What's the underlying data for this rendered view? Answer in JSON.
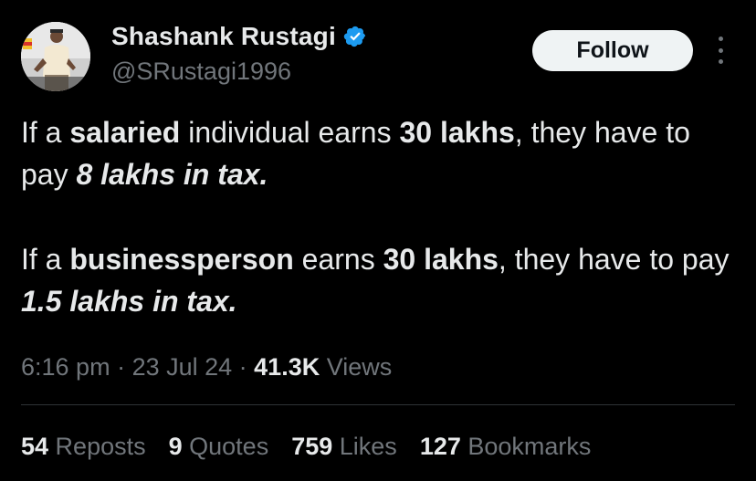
{
  "author": {
    "display_name": "Shashank Rustagi",
    "handle": "@SRustagi1996",
    "verified": true,
    "verified_color": "#1d9bf0"
  },
  "follow_button": {
    "label": "Follow"
  },
  "body": {
    "p1": {
      "t1": "If a ",
      "t2": "salaried",
      "t3": " individual earns ",
      "t4": "30 lakhs",
      "t5": ", they have to pay ",
      "t6": "8 lakhs in tax."
    },
    "p2": {
      "t1": "If a ",
      "t2": "businessperson",
      "t3": " earns ",
      "t4": "30 lakhs",
      "t5": ", they have to pay ",
      "t6": "1.5 lakhs in tax."
    }
  },
  "meta": {
    "time": "6:16 pm",
    "sep": " · ",
    "date": "23 Jul 24",
    "views_count": "41.3K",
    "views_label": " Views"
  },
  "stats": {
    "reposts_count": "54",
    "reposts_label": " Reposts",
    "quotes_count": "9",
    "quotes_label": " Quotes",
    "likes_count": "759",
    "likes_label": " Likes",
    "bookmarks_count": "127",
    "bookmarks_label": " Bookmarks"
  },
  "colors": {
    "background": "#000000",
    "text_primary": "#e7e9ea",
    "text_secondary": "#71767b",
    "divider": "#2f3336",
    "follow_bg": "#eff3f4"
  },
  "icons": [
    "verified-badge-icon",
    "more-options-icon",
    "avatar-photo"
  ]
}
